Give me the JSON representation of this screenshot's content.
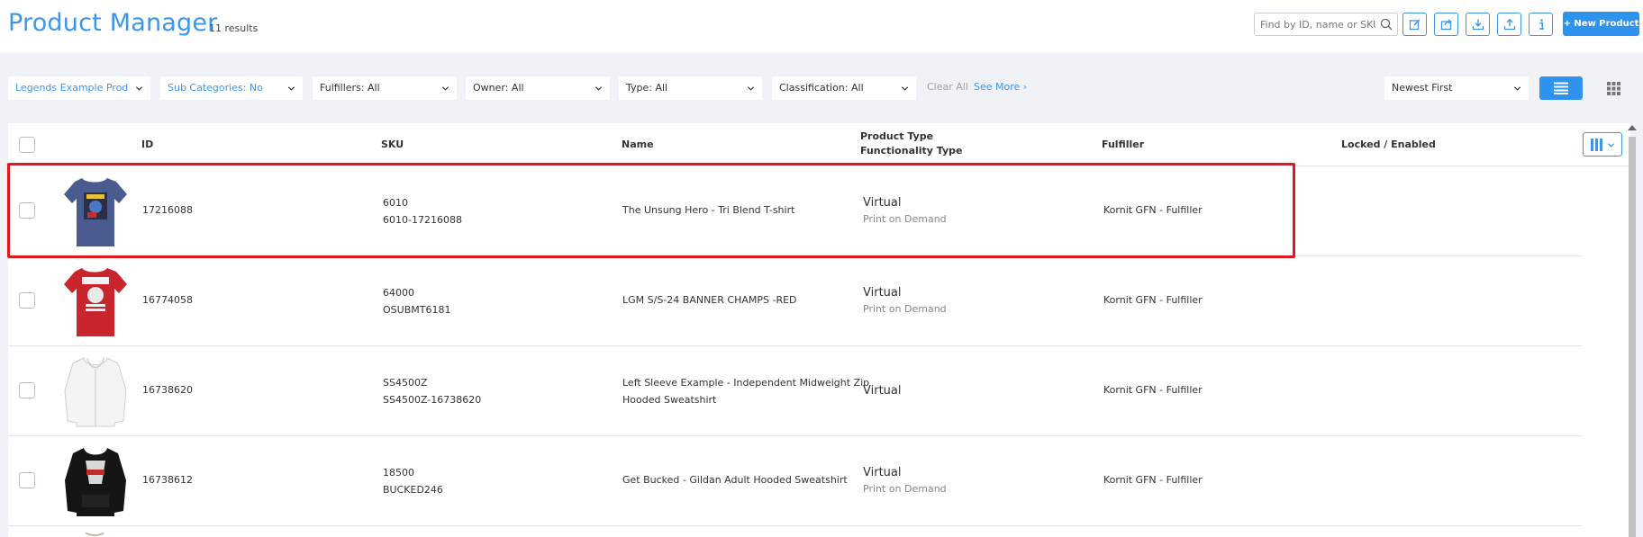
{
  "header": {
    "title": "Product Manager",
    "results": "11 results",
    "search_placeholder": "Find by ID, name or SKU...",
    "new_product_label": "+ New Product"
  },
  "filters": [
    {
      "label": "Legends Example Prod"
    },
    {
      "label": "Sub Categories: No"
    },
    {
      "label": "Fulfillers: All"
    },
    {
      "label": "Owner: All"
    },
    {
      "label": "Type: All"
    },
    {
      "label": "Classification: All"
    }
  ],
  "filter_actions": {
    "clear_all": "Clear All",
    "see_more": "See More ›"
  },
  "sort": {
    "selected": "Newest First"
  },
  "columns": {
    "id": "ID",
    "sku": "SKU",
    "name": "Name",
    "product_type": "Product Type",
    "functionality_type": "Functionality Type",
    "fulfiller": "Fulfiller",
    "locked_enabled": "Locked / Enabled"
  },
  "rows": [
    {
      "id": "17216088",
      "sku1": "6010",
      "sku2": "6010-17216088",
      "name1": "The Unsung Hero - Tri Blend T-shirt",
      "name2": "",
      "type": "Virtual",
      "func": "Print on Demand",
      "fulfiller": "Kornit GFN - Fulfiller",
      "thumb": "shirt-blue"
    },
    {
      "id": "16774058",
      "sku1": "64000",
      "sku2": "OSUBMT6181",
      "name1": "LGM S/S-24 BANNER CHAMPS -RED",
      "name2": "",
      "type": "Virtual",
      "func": "Print on Demand",
      "fulfiller": "Kornit GFN - Fulfiller",
      "thumb": "shirt-red"
    },
    {
      "id": "16738620",
      "sku1": "SS4500Z",
      "sku2": "SS4500Z-16738620",
      "name1": "Left Sleeve Example - Independent Midweight Zip",
      "name2": "Hooded Sweatshirt",
      "type": "Virtual",
      "func": "",
      "fulfiller": "Kornit GFN - Fulfiller",
      "thumb": "hoodie-white"
    },
    {
      "id": "16738612",
      "sku1": "18500",
      "sku2": "BUCKED246",
      "name1": "Get Bucked - Gildan Adult Hooded Sweatshirt",
      "name2": "",
      "type": "Virtual",
      "func": "Print on Demand",
      "fulfiller": "Kornit GFN - Fulfiller",
      "thumb": "hoodie-black"
    }
  ],
  "colors": {
    "accent": "#3d96e8",
    "primary_button": "#2e93ee",
    "highlight": "#e0181e"
  }
}
